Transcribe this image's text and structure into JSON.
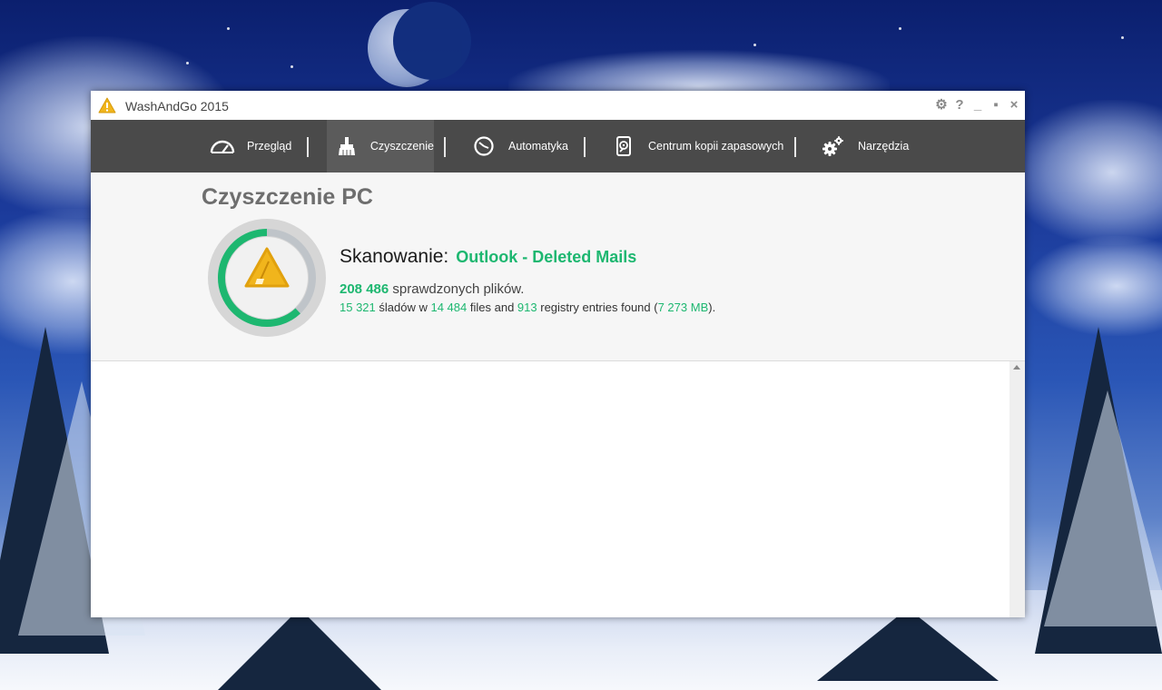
{
  "window": {
    "title": "WashAndGo 2015"
  },
  "controls": {
    "settings": "⚙",
    "help": "?",
    "minimize": "_",
    "maximize": "▪",
    "close": "×"
  },
  "nav": {
    "items": [
      {
        "label": "Przegląd",
        "icon": "speedometer-icon"
      },
      {
        "label": "Czyszczenie",
        "icon": "broom-icon"
      },
      {
        "label": "Automatyka",
        "icon": "clock-icon"
      },
      {
        "label": "Centrum kopii zapasowych",
        "icon": "backup-drive-icon"
      },
      {
        "label": "Narzędzia",
        "icon": "gears-icon"
      }
    ],
    "active": "Czyszczenie"
  },
  "scan": {
    "title": "Czyszczenie PC",
    "heading_label": "Skanowanie:",
    "target": "Outlook - Deleted Mails",
    "files_checked": "208 486",
    "files_checked_text": "sprawdzonych plików.",
    "traces": "15 321",
    "traces_text": "śladów w",
    "files": "14 484",
    "files_text": "files and",
    "registry": "913",
    "registry_text": "registry entries found (",
    "size": "7 273 MB",
    "size_suffix": ").",
    "progress": 0.62
  },
  "colors": {
    "accent": "#1db770",
    "navbar": "#4a4a4a",
    "warning": "#f1b51c"
  }
}
